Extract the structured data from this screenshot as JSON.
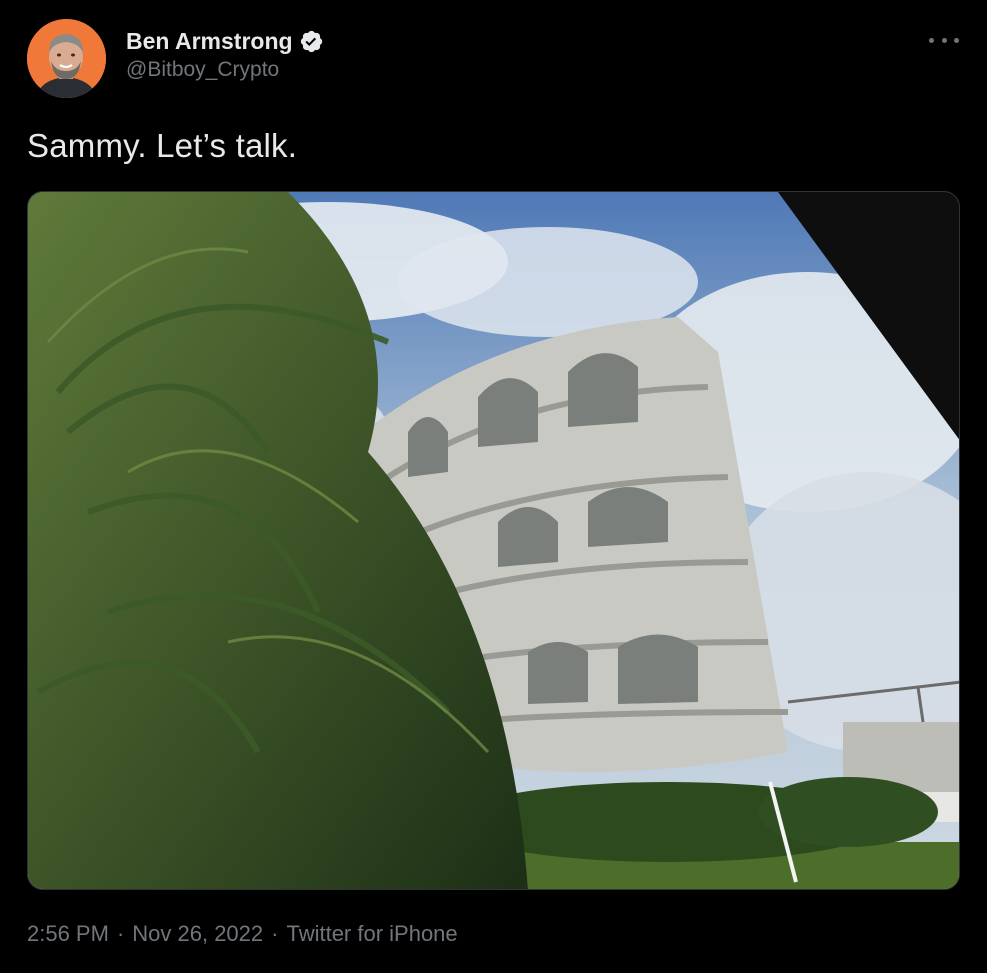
{
  "author": {
    "display_name": "Ben Armstrong",
    "handle": "@Bitboy_Crypto",
    "verified": true,
    "avatar_bg": "#f0793a"
  },
  "tweet": {
    "text": "Sammy. Let’s talk.",
    "photo_icon": "photo-image"
  },
  "meta": {
    "time": "2:56 PM",
    "separator": "·",
    "date": "Nov 26, 2022",
    "source": "Twitter for iPhone"
  },
  "colors": {
    "background": "#000000",
    "primary_text": "#e7e9ea",
    "secondary_text": "#71767b",
    "verified_badge": "#e7e9ea"
  },
  "icons": {
    "verified": "verified-badge-icon",
    "more": "more-dots-icon"
  }
}
